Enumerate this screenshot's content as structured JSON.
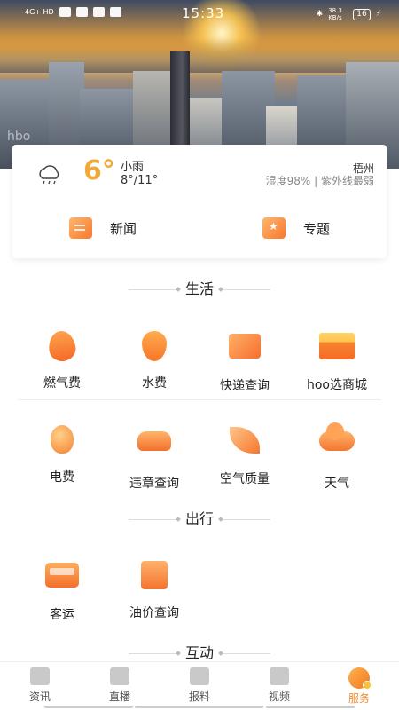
{
  "status_bar": {
    "network": "4G+ HD",
    "time": "15:33",
    "speed": "38.3 KB/s",
    "battery": "16"
  },
  "hero": {
    "watermark": "hbo"
  },
  "weather": {
    "temperature": "6°",
    "condition": "小雨",
    "range": "8°/11°",
    "city": "梧州",
    "details": "湿度98% | 紫外线最弱"
  },
  "quick_links": [
    {
      "label": "新闻",
      "icon": "news-icon"
    },
    {
      "label": "专题",
      "icon": "topic-star-icon"
    }
  ],
  "sections": {
    "life": {
      "title": "生活",
      "items": [
        {
          "label": "燃气费",
          "icon": "flame-icon"
        },
        {
          "label": "水费",
          "icon": "water-drop-icon"
        },
        {
          "label": "快递查询",
          "icon": "package-icon"
        },
        {
          "label": "hoo选商城",
          "icon": "shop-icon"
        },
        {
          "label": "电费",
          "icon": "lightbulb-icon"
        },
        {
          "label": "违章查询",
          "icon": "car-icon"
        },
        {
          "label": "空气质量",
          "icon": "leaf-icon"
        },
        {
          "label": "天气",
          "icon": "cloud-icon"
        }
      ]
    },
    "travel": {
      "title": "出行",
      "items": [
        {
          "label": "客运",
          "icon": "bus-icon"
        },
        {
          "label": "油价查询",
          "icon": "fuel-pump-icon"
        }
      ]
    },
    "interact": {
      "title": "互动"
    }
  },
  "tabbar": [
    {
      "label": "资讯",
      "icon": "news-tab-icon"
    },
    {
      "label": "直播",
      "icon": "tv-icon"
    },
    {
      "label": "报料",
      "icon": "camera-icon"
    },
    {
      "label": "视频",
      "icon": "video-icon"
    },
    {
      "label": "服务",
      "icon": "service-icon",
      "active": true
    }
  ],
  "colors": {
    "accent": "#f08a2d",
    "temperature": "#f0a93a"
  }
}
